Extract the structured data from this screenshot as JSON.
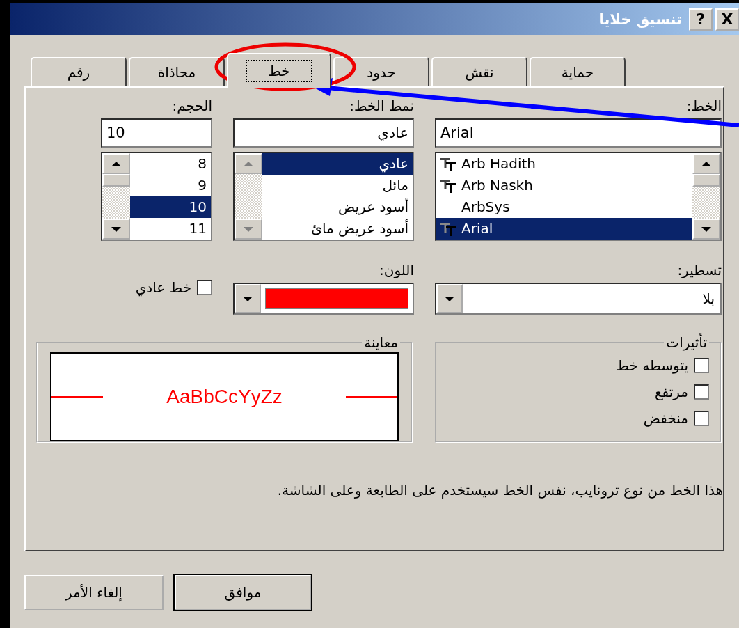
{
  "window": {
    "title": "تنسيق خلايا",
    "help": "?",
    "close": "X"
  },
  "tabs": [
    {
      "label": "حماية",
      "selected": false
    },
    {
      "label": "نقش",
      "selected": false
    },
    {
      "label": "حدود",
      "selected": false
    },
    {
      "label": "خط",
      "selected": true
    },
    {
      "label": "محاذاة",
      "selected": false
    },
    {
      "label": "رقم",
      "selected": false
    }
  ],
  "font": {
    "label": "الخط:",
    "value": "Arial",
    "items": [
      {
        "name": "Arb Hadith",
        "truetype": true,
        "selected": false
      },
      {
        "name": "Arb Naskh",
        "truetype": true,
        "selected": false
      },
      {
        "name": "ArbSys",
        "truetype": false,
        "selected": false
      },
      {
        "name": "Arial",
        "truetype": true,
        "selected": true
      }
    ]
  },
  "style": {
    "label": "نمط الخط:",
    "value": "عادي",
    "items": [
      {
        "name": "عادي",
        "selected": true
      },
      {
        "name": "مائل",
        "selected": false
      },
      {
        "name": "أسود عريض",
        "selected": false
      },
      {
        "name": "أسود عريض مائ",
        "selected": false
      }
    ]
  },
  "size": {
    "label": "الحجم:",
    "value": "10",
    "items": [
      {
        "name": "8",
        "selected": false
      },
      {
        "name": "9",
        "selected": false
      },
      {
        "name": "10",
        "selected": true
      },
      {
        "name": "11",
        "selected": false
      }
    ]
  },
  "underline": {
    "label": "تسطير:",
    "value": "بلا"
  },
  "color": {
    "label": "اللون:",
    "color": "#ff0000"
  },
  "normal_font": {
    "label": "خط عادي",
    "checked": false
  },
  "effects": {
    "title": "تأثيرات",
    "items": [
      {
        "label": "يتوسطه خط",
        "checked": false
      },
      {
        "label": "مرتفع",
        "checked": false
      },
      {
        "label": "منخفض",
        "checked": false
      }
    ]
  },
  "preview": {
    "title": "معاينة",
    "sample": "AaBbCcYyZz"
  },
  "description": "هذا الخط من نوع ترونايب، نفس الخط سيستخدم على الطابعة وعلى الشاشة.",
  "buttons": [
    {
      "label": "موافق",
      "default": true
    },
    {
      "label": "إلغاء الأمر",
      "default": false
    }
  ]
}
